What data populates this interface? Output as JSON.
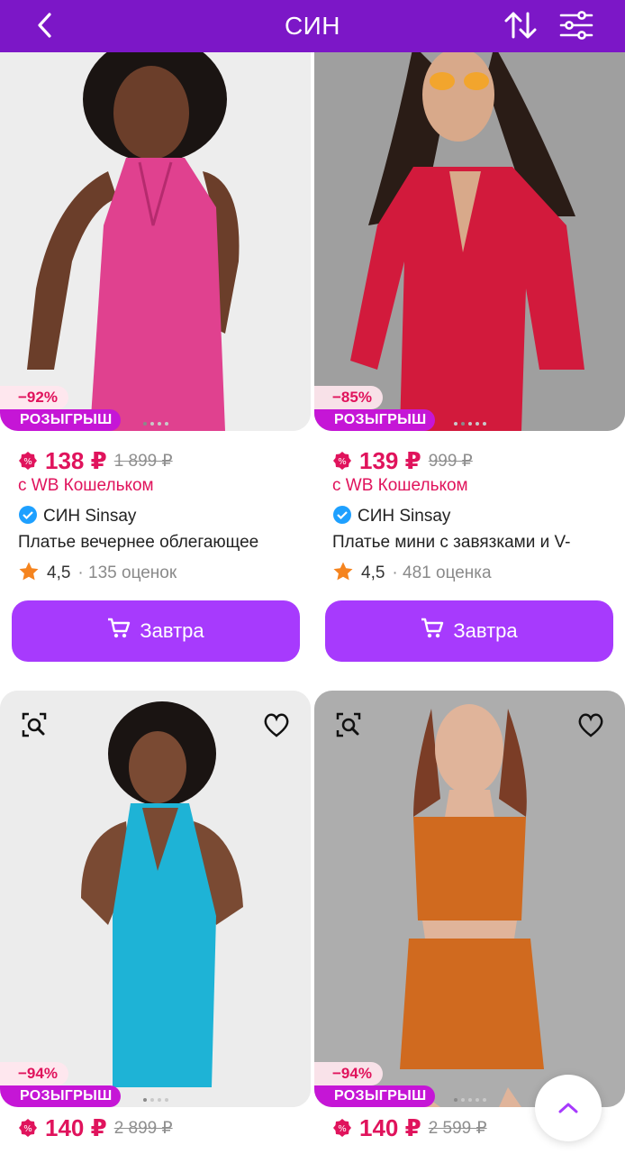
{
  "header": {
    "title": "СИН",
    "back_icon": "chevron-left-icon",
    "sort_icon": "sort-arrows-icon",
    "filter_icon": "sliders-icon",
    "background": "#7c17c7"
  },
  "colors": {
    "accent": "#a73afd",
    "price": "#e0135c",
    "promo_badge": "#c516d6",
    "star": "#f5841f",
    "verified": "#1ea0ff"
  },
  "products": [
    {
      "discount": "−92%",
      "promo": "РОЗЫГРЫШ",
      "price": "138 ₽",
      "old_price": "1 899 ₽",
      "wallet": "с WB Кошельком",
      "brand": "СИН Sinsay",
      "name": "Платье вечернее облегающее",
      "rating": "4,5",
      "reviews": "· 135 оценок",
      "button": "Завтра",
      "dress_color": "#e0418f"
    },
    {
      "discount": "−85%",
      "promo": "РОЗЫГРЫШ",
      "price": "139 ₽",
      "old_price": "999 ₽",
      "wallet": "с WB Кошельком",
      "brand": "СИН Sinsay",
      "name": "Платье мини с завязками и V-",
      "rating": "4,5",
      "reviews": "· 481 оценка",
      "button": "Завтра",
      "dress_color": "#d21a3c"
    },
    {
      "discount": "−94%",
      "promo": "РОЗЫГРЫШ",
      "price": "140 ₽",
      "old_price": "2 899 ₽",
      "dress_color": "#1eb3d6"
    },
    {
      "discount": "−94%",
      "promo": "РОЗЫГРЫШ",
      "price": "140 ₽",
      "old_price": "2 599 ₽",
      "dress_color": "#d06a1f"
    }
  ],
  "scroll_top_icon": "chevron-up-icon"
}
